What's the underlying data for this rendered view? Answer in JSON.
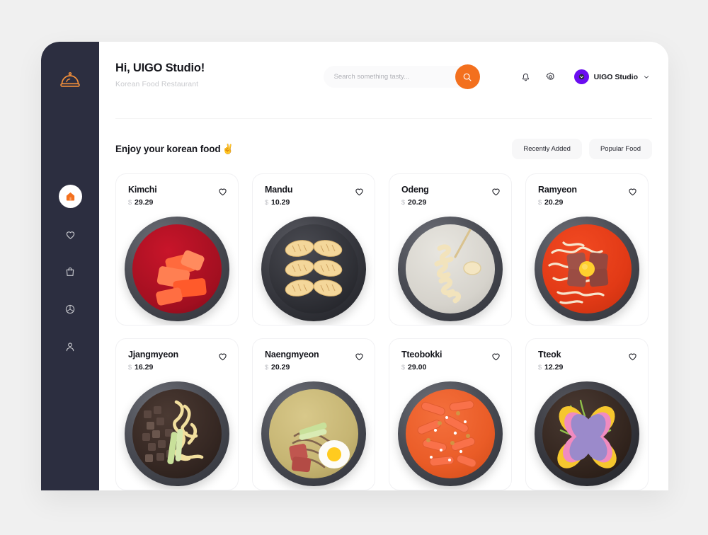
{
  "app": {
    "brand_logo_icon": "cloche-food-dome-icon",
    "sidebar_bg": "#2C2E40",
    "accent_orange": "#F3701E",
    "avatar_purple": "#6A0DF0"
  },
  "sidebar": {
    "items": [
      {
        "icon": "home-icon",
        "name": "home",
        "active": true
      },
      {
        "icon": "heart-icon",
        "name": "favorites",
        "active": false
      },
      {
        "icon": "shopping-bag-icon",
        "name": "orders",
        "active": false
      },
      {
        "icon": "package-box-icon",
        "name": "delivery",
        "active": false
      },
      {
        "icon": "person-icon",
        "name": "profile",
        "active": false
      }
    ]
  },
  "header": {
    "greeting": "Hi, UIGO Studio!",
    "subtitle": "Korean Food Restaurant",
    "search": {
      "placeholder": "Search something tasty...",
      "value": "",
      "button_icon": "search-icon"
    },
    "notification_icon": "bell-icon",
    "settings_icon": "gear-icon",
    "profile": {
      "name": "UIGO Studio",
      "avatar_icon": "avatar-icon",
      "chevron_icon": "chevron-down-icon"
    }
  },
  "section": {
    "title": "Enjoy your korean food",
    "title_emoji": "✌",
    "filters": [
      {
        "label": "Recently Added"
      },
      {
        "label": "Popular Food"
      }
    ]
  },
  "food_cards": [
    {
      "name": "Kimchi",
      "currency": "$",
      "price": "29.29",
      "favorite_icon": "heart-outline-icon",
      "image": "kimchi-bowl"
    },
    {
      "name": "Mandu",
      "currency": "$",
      "price": "10.29",
      "favorite_icon": "heart-outline-icon",
      "image": "mandu-pan"
    },
    {
      "name": "Odeng",
      "currency": "$",
      "price": "20.29",
      "favorite_icon": "heart-outline-icon",
      "image": "odeng-broth"
    },
    {
      "name": "Ramyeon",
      "currency": "$",
      "price": "20.29",
      "favorite_icon": "heart-outline-icon",
      "image": "ramyeon-bowl"
    },
    {
      "name": "Jjangmyeon",
      "currency": "$",
      "price": "16.29",
      "favorite_icon": "heart-outline-icon",
      "image": "jjangmyeon-bowl"
    },
    {
      "name": "Naengmyeon",
      "currency": "$",
      "price": "20.29",
      "favorite_icon": "heart-outline-icon",
      "image": "naengmyeon-bowl"
    },
    {
      "name": "Tteobokki",
      "currency": "$",
      "price": "29.00",
      "favorite_icon": "heart-outline-icon",
      "image": "tteobokki-bowl"
    },
    {
      "name": "Tteok",
      "currency": "$",
      "price": "12.29",
      "favorite_icon": "heart-outline-icon",
      "image": "tteok-bowl"
    }
  ]
}
